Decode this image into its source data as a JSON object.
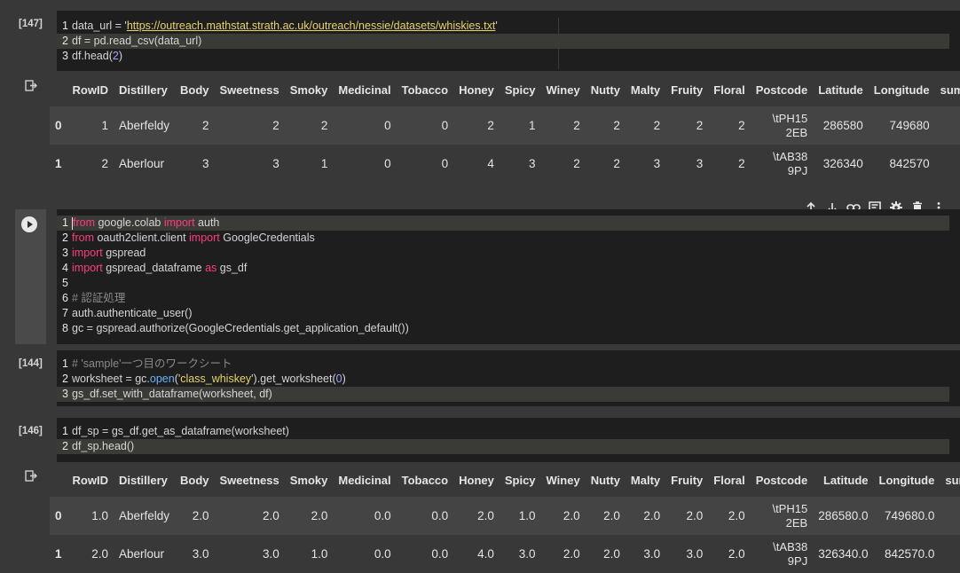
{
  "cells": {
    "cell1": {
      "exec": "[147]",
      "lines": [
        "1",
        "2",
        "3"
      ],
      "url": "https://outreach.mathstat.strath.ac.uk/outreach/nessie/datasets/whiskies.txt"
    },
    "cell2": {
      "lines": [
        "1",
        "2",
        "3",
        "4",
        "5",
        "6",
        "7",
        "8"
      ],
      "comment": "# 認証処理"
    },
    "cell3": {
      "exec": "[144]",
      "lines": [
        "1",
        "2",
        "3"
      ],
      "comment": "# 'sample'一つ目のワークシート"
    },
    "cell4": {
      "exec": "[146]",
      "lines": [
        "1",
        "2"
      ]
    }
  },
  "table": {
    "headers": [
      "RowID",
      "Distillery",
      "Body",
      "Sweetness",
      "Smoky",
      "Medicinal",
      "Tobacco",
      "Honey",
      "Spicy",
      "Winey",
      "Nutty",
      "Malty",
      "Fruity",
      "Floral",
      "Postcode",
      "Latitude",
      "Longitude",
      "sum_w"
    ],
    "rows": [
      {
        "idx": "0",
        "cells": [
          "1",
          "Aberfeldy",
          "2",
          "2",
          "2",
          "0",
          "0",
          "2",
          "1",
          "2",
          "2",
          "2",
          "2",
          "2"
        ],
        "postcode": [
          "\\tPH15",
          "2EB"
        ],
        "lat": "286580",
        "lon": "749680"
      },
      {
        "idx": "1",
        "cells": [
          "2",
          "Aberlour",
          "3",
          "3",
          "1",
          "0",
          "0",
          "4",
          "3",
          "2",
          "2",
          "3",
          "3",
          "2"
        ],
        "postcode": [
          "\\tAB38",
          "9PJ"
        ],
        "lat": "326340",
        "lon": "842570"
      }
    ]
  },
  "table2": {
    "headers": [
      "RowID",
      "Distillery",
      "Body",
      "Sweetness",
      "Smoky",
      "Medicinal",
      "Tobacco",
      "Honey",
      "Spicy",
      "Winey",
      "Nutty",
      "Malty",
      "Fruity",
      "Floral",
      "Postcode",
      "Latitude",
      "Longitude",
      "sum_"
    ],
    "rows": [
      {
        "idx": "0",
        "cells": [
          "1.0",
          "Aberfeldy",
          "2.0",
          "2.0",
          "2.0",
          "0.0",
          "0.0",
          "2.0",
          "1.0",
          "2.0",
          "2.0",
          "2.0",
          "2.0",
          "2.0"
        ],
        "postcode": [
          "\\tPH15",
          "2EB"
        ],
        "lat": "286580.0",
        "lon": "749680.0"
      },
      {
        "idx": "1",
        "cells": [
          "2.0",
          "Aberlour",
          "3.0",
          "3.0",
          "1.0",
          "0.0",
          "0.0",
          "4.0",
          "3.0",
          "2.0",
          "2.0",
          "3.0",
          "3.0",
          "2.0"
        ],
        "postcode": [
          "\\tAB38",
          "9PJ"
        ],
        "lat": "326340.0",
        "lon": "842570.0"
      }
    ]
  },
  "icons": {
    "up": "arrow-up-icon",
    "down": "arrow-down-icon",
    "link": "link-icon",
    "comment": "comment-icon",
    "settings": "gear-icon",
    "delete": "trash-icon",
    "more": "more-icon"
  }
}
